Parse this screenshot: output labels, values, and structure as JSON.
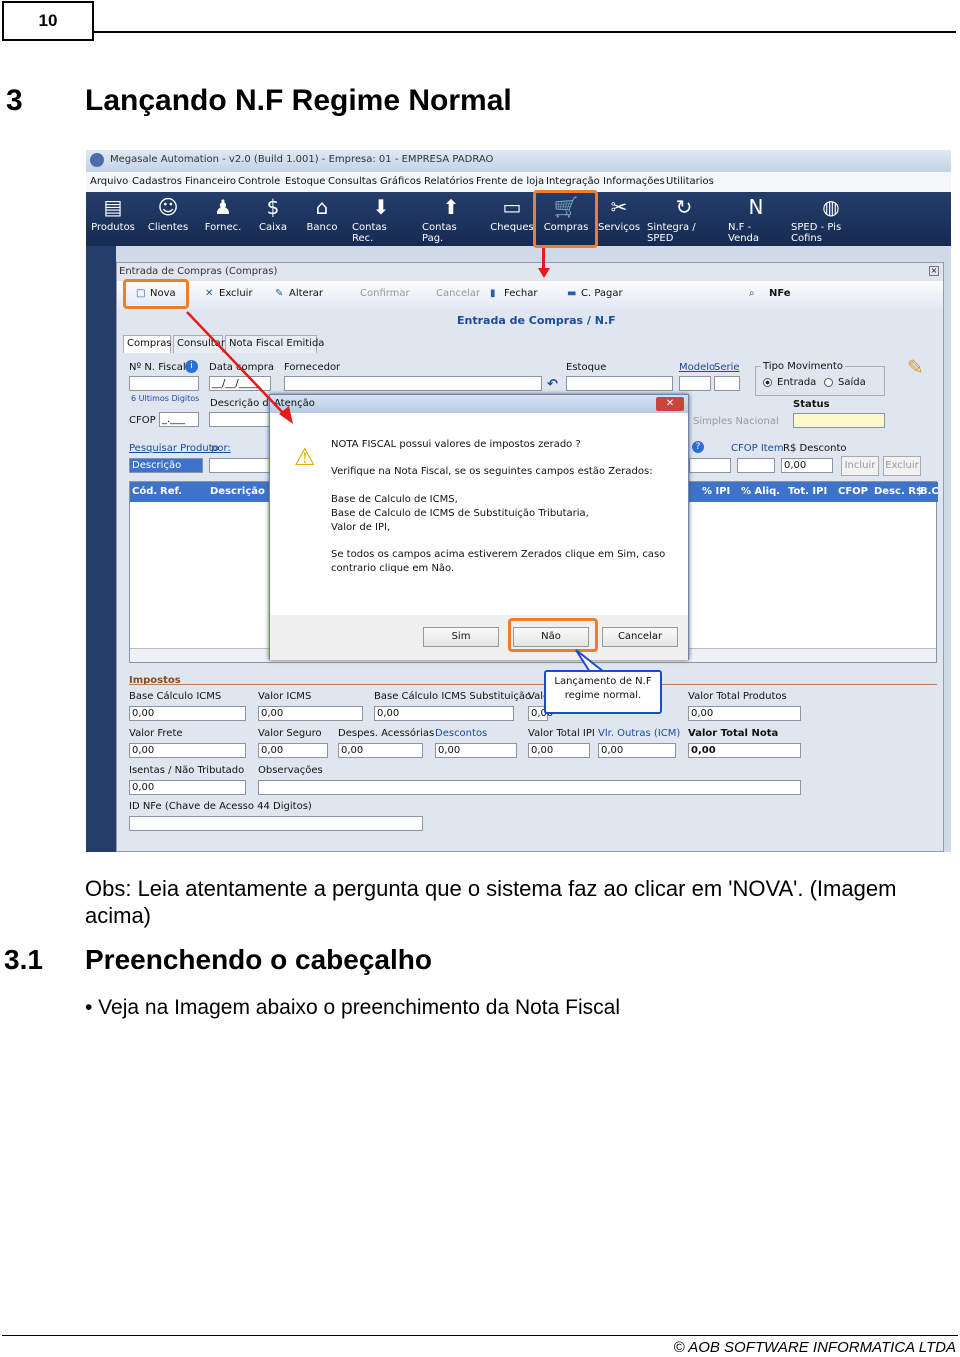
{
  "page": {
    "number": "10",
    "heading_number": "3",
    "heading": "Lançando N.F Regime Normal",
    "obs": "Obs: Leia atentamente a pergunta que o sistema faz ao clicar em 'NOVA'. (Imagem acima)",
    "subheading_number": "3.1",
    "subheading": "Preenchendo o cabeçalho",
    "bullet": "• Veja na Imagem abaixo o preenchimento da Nota Fiscal",
    "footer": "© AOB SOFTWARE INFORMATICA LTDA"
  },
  "app": {
    "title": "Megasale Automation - v2.0  (Build 1.001)  -  Empresa: 01 - EMPRESA PADRAO",
    "menu": [
      "Arquivo",
      "Cadastros",
      "Financeiro",
      "Controle",
      "Estoque",
      "Consultas",
      "Gráficos",
      "Relatórios",
      "Frente de loja",
      "Integração",
      "Informações",
      "Utilitarios"
    ],
    "toolbar": [
      "Produtos",
      "Clientes",
      "Fornec.",
      "Caixa",
      "Banco",
      "Contas Rec.",
      "Contas Pag.",
      "Cheques",
      "Compras",
      "Serviços",
      "Sintegra / SPED",
      "N.F - Venda",
      "SPED - Pis Cofins"
    ],
    "toolbar_icons": [
      "boxes-icon",
      "people-icon",
      "person-icon",
      "dollar-icon",
      "bank-icon",
      "receive-icon",
      "pay-icon",
      "cheque-icon",
      "cart-icon",
      "tools-icon",
      "sync-icon",
      "nfe-icon",
      "globe-icon"
    ]
  },
  "window": {
    "title": "Entrada de Compras  (Compras)",
    "buttons": [
      "Nova",
      "Excluir",
      "Alterar",
      "Confirmar",
      "Cancelar",
      "Fechar",
      "C. Pagar"
    ],
    "nfe_button": "NFe",
    "header_title": "Entrada de Compras / N.F",
    "tabs": [
      "Compras",
      "Consultar",
      "Nota Fiscal Emitida"
    ],
    "labels": {
      "nf": "Nº N. Fiscal",
      "data": "Data compra",
      "fornecedor": "Fornecedor",
      "estoque": "Estoque",
      "modelo": "Modelo",
      "serie": "Serie",
      "tipo": "Tipo Movimento",
      "entrada": "Entrada",
      "saida": "Saída",
      "ultimos": "6 Ultimos Digitos",
      "descricao_do": "Descrição do",
      "status": "Status",
      "simples": "Simples Nacional",
      "cfop": "CFOP",
      "pesquisar": "Pesquisar Produto",
      "por": "por:",
      "cfop_item": "CFOP Item",
      "rs_desconto": "R$ Desconto",
      "incluir": "Incluir",
      "excluir": "Excluir"
    },
    "values": {
      "data": "__/__/____",
      "cfop": "_.___",
      "descricao_select": "Descrição",
      "desconto": "0,00"
    },
    "grid_headers_left": [
      "Cód.",
      "Ref.",
      "Descrição"
    ],
    "grid_headers_right": [
      "% IPI",
      "% Aliq.",
      "Tot. IPI",
      "CFOP",
      "Desc. R$",
      "B.C"
    ],
    "impostos_title": "Impostos",
    "impostos": [
      {
        "label": "Base Cálculo ICMS",
        "value": "0,00"
      },
      {
        "label": "Valor ICMS",
        "value": "0,00"
      },
      {
        "label": "Base Cálculo ICMS Substituição",
        "value": "0,00"
      },
      {
        "label": "Valo",
        "value": "0,00"
      },
      {
        "label": "Valor Total Produtos",
        "value": "0,00"
      },
      {
        "label": "Valor Frete",
        "value": "0,00"
      },
      {
        "label": "Valor Seguro",
        "value": "0,00"
      },
      {
        "label": "Despes. Acessórias",
        "value": "0,00"
      },
      {
        "label": "Descontos",
        "value": "0,00"
      },
      {
        "label": "Valor Total IPI",
        "value": "0,00"
      },
      {
        "label": "Vlr. Outras (ICM)",
        "value": "0,00"
      },
      {
        "label": "Valor Total Nota",
        "value": "0,00"
      },
      {
        "label": "Isentas / Não Tributado",
        "value": "0,00"
      },
      {
        "label": "Observações",
        "value": ""
      },
      {
        "label": "ID NFe (Chave de Acesso 44 Digitos)",
        "value": ""
      }
    ]
  },
  "dialog": {
    "title": "Atenção",
    "line1": "NOTA FISCAL possui valores de impostos zerado ?",
    "line2": "Verifique na Nota Fiscal, se os seguintes campos estão Zerados:",
    "line3": "Base de Calculo de ICMS,",
    "line4": "Base de Calculo de ICMS de Substituição Tributaria,",
    "line5": "Valor de IPI,",
    "line6": "Se todos os campos acima estiverem Zerados clique em Sim, caso",
    "line7": "contrario clique em Não.",
    "btn_sim": "Sim",
    "btn_nao": "Não",
    "btn_cancelar": "Cancelar"
  },
  "callout": "Lançamento de N.F regime normal.",
  "colors": {
    "highlight": "#f07d2a",
    "arrow": "#e51a1a",
    "toolbar": "#1d3460",
    "grid_header": "#3d74c9"
  }
}
